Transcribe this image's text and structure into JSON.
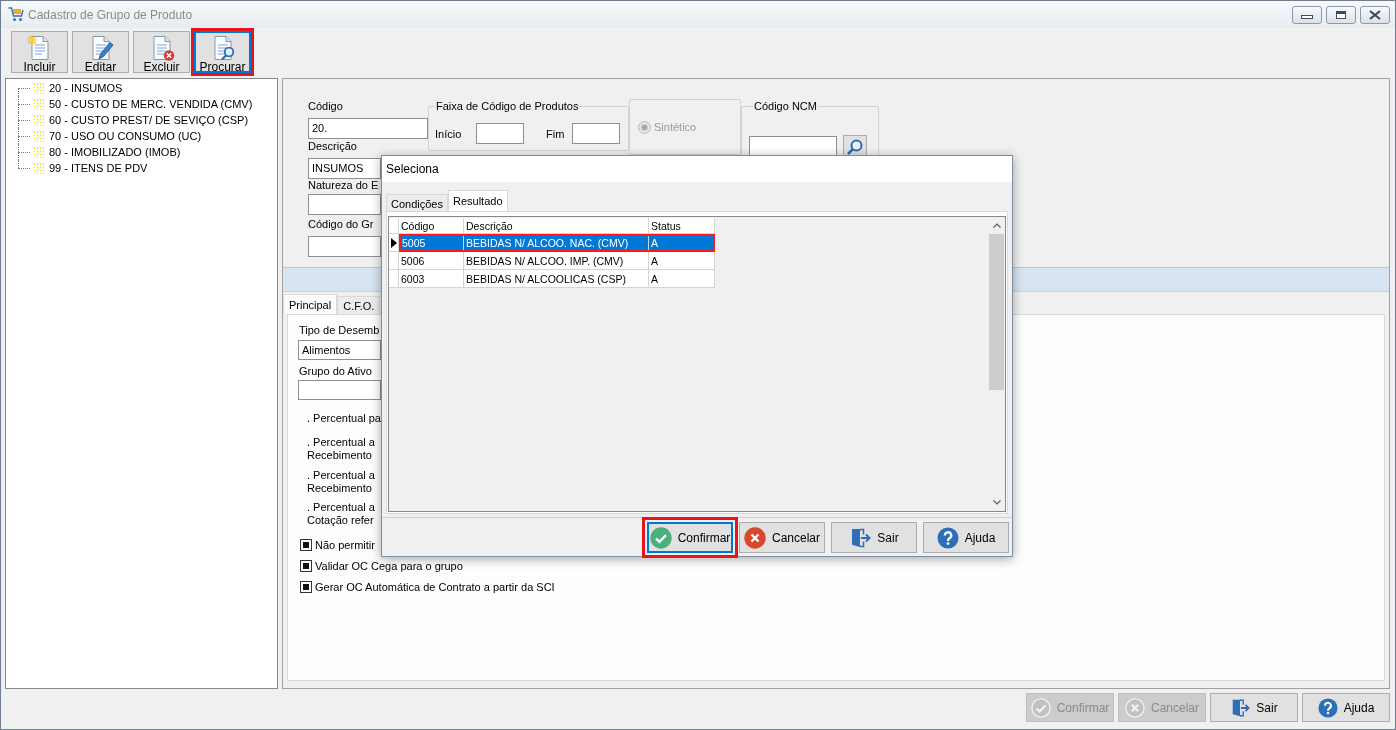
{
  "window": {
    "title": "Cadastro de Grupo de Produto"
  },
  "toolbar": [
    {
      "label": "Incluir",
      "kind": "add",
      "focused": false,
      "highlighted": false
    },
    {
      "label": "Editar",
      "kind": "edit",
      "focused": false,
      "highlighted": false
    },
    {
      "label": "Excluir",
      "kind": "delete",
      "focused": false,
      "highlighted": false
    },
    {
      "label": "Procurar",
      "kind": "search",
      "focused": true,
      "highlighted": true
    }
  ],
  "tree": [
    {
      "label": "20 - INSUMOS"
    },
    {
      "label": "50 - CUSTO DE MERC. VENDIDA (CMV)"
    },
    {
      "label": "60 - CUSTO PREST/ DE SEVIÇO (CSP)"
    },
    {
      "label": "70 - USO OU CONSUMO (UC)"
    },
    {
      "label": "80 - IMOBILIZADO (IMOB)"
    },
    {
      "label": "99 - ITENS DE PDV"
    }
  ],
  "form": {
    "code": {
      "label": "Código",
      "value": "20."
    },
    "description": {
      "label": "Descrição",
      "value": "INSUMOS"
    },
    "nature": {
      "label": "Natureza do E"
    },
    "group_code": {
      "label": "Código do Gr"
    },
    "range": {
      "title": "Faixa de Código de Produtos",
      "start_label": "Início",
      "end_label": "Fim"
    },
    "synthetic": {
      "label": "Sintético",
      "selected": true,
      "disabled": true
    },
    "ncm": {
      "title": "Código NCM"
    }
  },
  "tabs": [
    {
      "label": "Principal",
      "selected": true
    },
    {
      "label": "C.F.O.",
      "selected": false
    }
  ],
  "principal": {
    "expense_type": {
      "label": "Tipo de Desemb",
      "value": "Alimentos"
    },
    "asset_group": {
      "label": "Grupo do Ativo"
    },
    "notes": [
      {
        "lines": [
          ". Percentual pa"
        ]
      },
      {
        "lines": [
          ". Percentual a",
          "Recebimento"
        ]
      },
      {
        "lines": [
          ". Percentual a",
          "Recebimento"
        ]
      },
      {
        "lines": [
          ". Percentual a",
          "Cotação refer"
        ]
      }
    ],
    "checkboxes": [
      {
        "label": "Não permitir",
        "checked": true
      },
      {
        "label": "Validar OC Cega para o grupo",
        "checked": true
      },
      {
        "label": "Gerar OC Automática de Contrato a partir da SCI",
        "checked": true
      }
    ]
  },
  "dialog": {
    "title": "Seleciona",
    "tabs": [
      {
        "label": "Condições",
        "selected": false
      },
      {
        "label": "Resultado",
        "selected": true
      }
    ],
    "columns": [
      "Código",
      "Descrição",
      "Status"
    ],
    "rows": [
      {
        "cells": [
          "5005",
          "BEBIDAS N/ ALCOO. NAC. (CMV)",
          "A"
        ],
        "selected": true,
        "highlighted": true
      },
      {
        "cells": [
          "5006",
          "BEBIDAS N/ ALCOO. IMP. (CMV)",
          "A"
        ],
        "selected": false,
        "highlighted": false
      },
      {
        "cells": [
          "6003",
          "BEBIDAS N/ ALCOOLICAS (CSP)",
          "A"
        ],
        "selected": false,
        "highlighted": false
      }
    ],
    "buttons": [
      {
        "label": "Confirmar",
        "kind": "confirm",
        "focused": true,
        "highlighted": true
      },
      {
        "label": "Cancelar",
        "kind": "cancel",
        "focused": false,
        "highlighted": false
      },
      {
        "label": "Sair",
        "kind": "exit",
        "focused": false,
        "highlighted": false
      },
      {
        "label": "Ajuda",
        "kind": "help",
        "focused": false,
        "highlighted": false
      }
    ]
  },
  "buttons": [
    {
      "label": "Confirmar",
      "kind": "confirm",
      "disabled": true
    },
    {
      "label": "Cancelar",
      "kind": "cancel",
      "disabled": true
    },
    {
      "label": "Sair",
      "kind": "exit",
      "disabled": false
    },
    {
      "label": "Ajuda",
      "kind": "help",
      "disabled": false
    }
  ]
}
